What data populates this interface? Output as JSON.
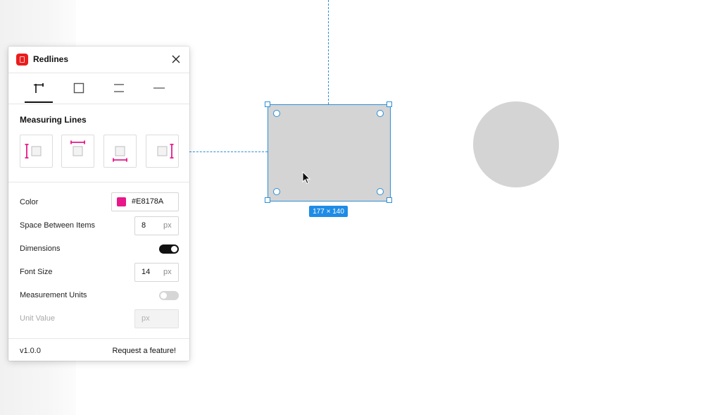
{
  "panel": {
    "title": "Redlines",
    "tabs": [
      {
        "icon": "measure-lines-icon"
      },
      {
        "icon": "square-outline-icon"
      },
      {
        "icon": "spacing-lines-icon"
      },
      {
        "icon": "single-line-icon"
      }
    ],
    "section_title": "Measuring Lines",
    "measure_options": [
      {
        "icon": "measure-left-icon"
      },
      {
        "icon": "measure-top-icon"
      },
      {
        "icon": "measure-bottom-icon"
      },
      {
        "icon": "measure-right-icon"
      }
    ],
    "settings": {
      "color_label": "Color",
      "color_value": "#E8178A",
      "space_label": "Space Between Items",
      "space_value": "8",
      "space_unit": "px",
      "dimensions_label": "Dimensions",
      "dimensions_on": true,
      "font_size_label": "Font Size",
      "font_size_value": "14",
      "font_size_unit": "px",
      "units_label": "Measurement Units",
      "units_on": false,
      "unit_value_label": "Unit Value",
      "unit_value_placeholder": "px"
    },
    "footer": {
      "version": "v1.0.0",
      "link": "Request a feature!"
    }
  },
  "canvas": {
    "selection_size": "177 × 140",
    "accent_color": "#2d8fd6",
    "shape_fill": "#d4d4d4"
  }
}
